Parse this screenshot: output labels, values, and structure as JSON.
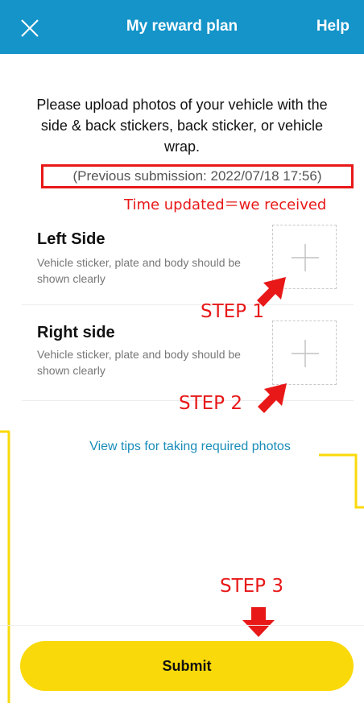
{
  "header": {
    "title": "My reward plan",
    "help_label": "Help",
    "close_icon": "close-icon",
    "background": "#1494c9"
  },
  "instructions": "Please upload photos of your vehicle with the side & back stickers, back sticker, or vehicle wrap.",
  "previous_submission": "(Previous submission: 2022/07/18 17:56)",
  "upload_items": [
    {
      "title": "Left Side",
      "description": "Vehicle sticker, plate and body should be shown clearly",
      "add_icon": "plus-icon"
    },
    {
      "title": "Right side",
      "description": "Vehicle sticker, plate and body should be shown clearly",
      "add_icon": "plus-icon"
    }
  ],
  "tips_link": "View tips for taking required photos",
  "submit_label": "Submit",
  "annotations": {
    "time_note": "Time updated＝we received",
    "step1": "STEP 1",
    "step2": "STEP 2",
    "step3": "STEP 3",
    "red": "#e81818",
    "yellow": "#fad90a"
  }
}
